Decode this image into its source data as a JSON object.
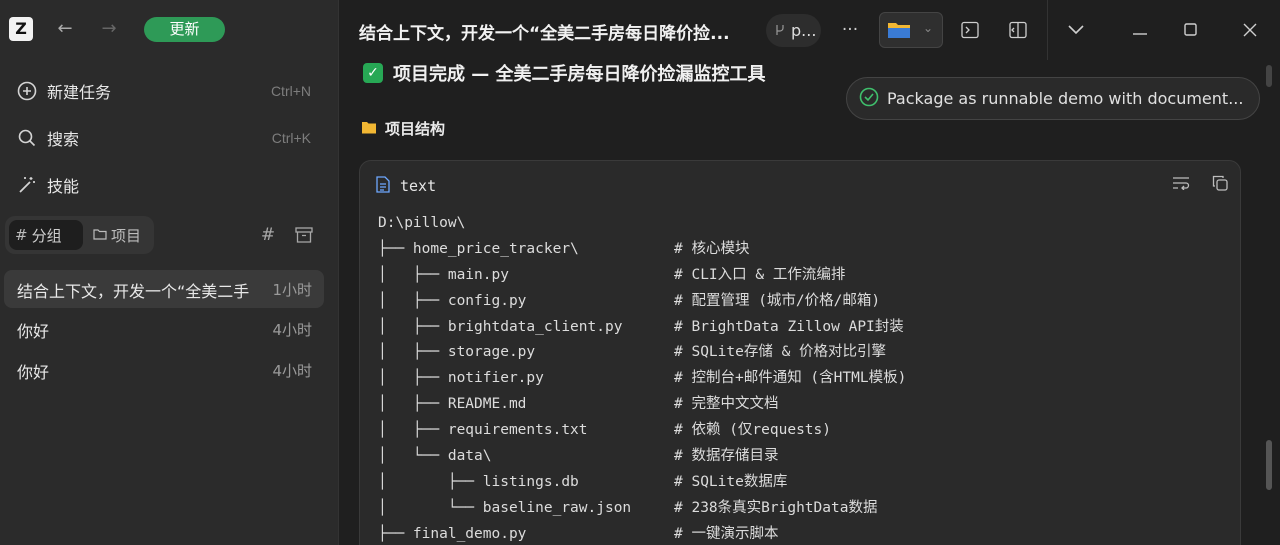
{
  "app": {
    "logo_letter": "Z",
    "back_icon": "←",
    "forward_icon": "→",
    "update_label": "更新"
  },
  "sidebar": {
    "menu": [
      {
        "label": "新建任务",
        "shortcut": "Ctrl+N"
      },
      {
        "label": "搜索",
        "shortcut": "Ctrl+K"
      },
      {
        "label": "技能",
        "shortcut": ""
      }
    ],
    "segments": {
      "group_label": "分组",
      "project_label": "项目"
    },
    "tasks": [
      {
        "title": "结合上下文，开发一个“全美二手",
        "time": "1小时"
      },
      {
        "title": "你好",
        "time": "4小时"
      },
      {
        "title": "你好",
        "time": "4小时"
      }
    ]
  },
  "topbar": {
    "title": "结合上下文，开发一个“全美二手房每日降价捡...",
    "chip_label": "p..."
  },
  "content": {
    "heading": "项目完成 — 全美二手房每日降价捡漏监控工具",
    "subheading": "项目结构",
    "toast": "Package as runnable demo with document...",
    "code_lang": "text",
    "code_lines": [
      {
        "t": "D:\\pillow\\",
        "c": ""
      },
      {
        "t": "├── home_price_tracker\\",
        "c": "# 核心模块"
      },
      {
        "t": "│   ├── main.py",
        "c": "# CLI入口 & 工作流编排"
      },
      {
        "t": "│   ├── config.py",
        "c": "# 配置管理 (城市/价格/邮箱)"
      },
      {
        "t": "│   ├── brightdata_client.py",
        "c": "# BrightData Zillow API封装"
      },
      {
        "t": "│   ├── storage.py",
        "c": "# SQLite存储 & 价格对比引擎"
      },
      {
        "t": "│   ├── notifier.py",
        "c": "# 控制台+邮件通知 (含HTML模板)"
      },
      {
        "t": "│   ├── README.md",
        "c": "# 完整中文文档"
      },
      {
        "t": "│   ├── requirements.txt",
        "c": "# 依赖 (仅requests)"
      },
      {
        "t": "│   └── data\\",
        "c": "# 数据存储目录"
      },
      {
        "t": "│       ├── listings.db",
        "c": "# SQLite数据库"
      },
      {
        "t": "│       └── baseline_raw.json",
        "c": "# 238条真实BrightData数据"
      },
      {
        "t": "├── final_demo.py",
        "c": "# 一键演示脚本"
      }
    ]
  }
}
